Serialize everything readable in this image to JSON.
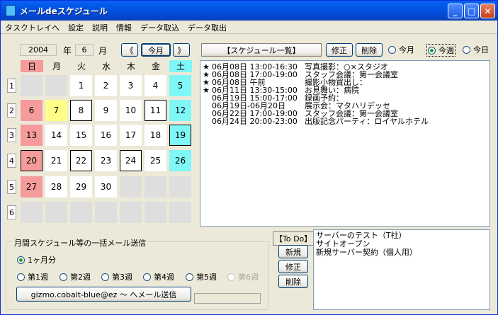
{
  "window": {
    "title": "メールdeスケジュール"
  },
  "menu": [
    "タスクトレイへ",
    "設定",
    "説明",
    "情報",
    "データ取込",
    "データ取出"
  ],
  "calendar": {
    "year": "2004",
    "year_label": "年",
    "month": "6",
    "month_label": "月",
    "prev_label": "《",
    "this_month_label": "今月",
    "next_label": "》",
    "weekdays": [
      "日",
      "月",
      "火",
      "水",
      "木",
      "金",
      "土"
    ],
    "week_numbers": [
      "1",
      "2",
      "3",
      "4",
      "5",
      "6"
    ],
    "weeks": [
      [
        "",
        "",
        "1",
        "2",
        "3",
        "4",
        "5"
      ],
      [
        "6",
        "7",
        "8",
        "9",
        "10",
        "11",
        "12"
      ],
      [
        "13",
        "14",
        "15",
        "16",
        "17",
        "18",
        "19"
      ],
      [
        "20",
        "21",
        "22",
        "23",
        "24",
        "25",
        "26"
      ],
      [
        "27",
        "28",
        "29",
        "30",
        "",
        "",
        ""
      ],
      [
        "",
        "",
        "",
        "",
        "",
        "",
        ""
      ]
    ],
    "today": "7",
    "scheduled_days": [
      "8",
      "11",
      "19",
      "20",
      "22",
      "24"
    ]
  },
  "schedule": {
    "header": "【スケジュール一覧】",
    "edit_label": "修正",
    "delete_label": "削除",
    "range_options": [
      "今月",
      "今週",
      "今日"
    ],
    "range_selected": "今週",
    "items": [
      {
        "star": "★",
        "date": "06月08日 13:00-16:30",
        "text": "写真撮影：○×スタジオ"
      },
      {
        "star": "★",
        "date": "06月08日 17:00-19:00",
        "text": "スタッフ会議：第一会議室"
      },
      {
        "star": "★",
        "date": "06月08日 午前",
        "text": "撮影小物買出し："
      },
      {
        "star": "★",
        "date": "06月11日 13:30-15:00",
        "text": "お見舞い：病院"
      },
      {
        "star": "",
        "date": "06月19日 15:00-17:00",
        "text": "録画予約："
      },
      {
        "star": "",
        "date": "06月19日-06月20日",
        "text": "展示会：マタハリデッセ"
      },
      {
        "star": "",
        "date": "06月22日 17:00-19:00",
        "text": "スタッフ会議：第一会議室"
      },
      {
        "star": "",
        "date": "06月24日 20:00-23:00",
        "text": "出版記念パーティ：ロイヤルホテル"
      }
    ]
  },
  "mail": {
    "group_title": "月間スケジュール等の一括メール送信",
    "month_option": "1ヶ月分",
    "week_options": [
      "第1週",
      "第2週",
      "第3週",
      "第4週",
      "第5週",
      "第6週"
    ],
    "send_label": "gizmo.cobalt-blue@ez 〜 へメール送信"
  },
  "todo": {
    "header": "【To Do】",
    "new_label": "新規",
    "edit_label": "修正",
    "delete_label": "削除",
    "items": [
      "サーバーのテスト（T社）",
      "サイトオープン",
      "新規サーバー契約（個人用）"
    ]
  }
}
